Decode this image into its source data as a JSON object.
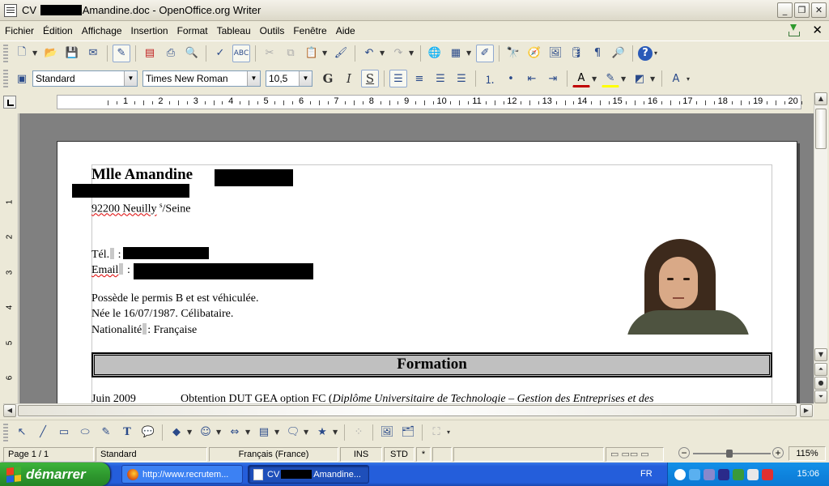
{
  "window": {
    "title_prefix": "CV",
    "title_suffix": "Amandine.doc - OpenOffice.org Writer",
    "minimize": "_",
    "maximize": "❐",
    "close": "✕"
  },
  "menu": {
    "items": [
      "Fichier",
      "Édition",
      "Affichage",
      "Insertion",
      "Format",
      "Tableau",
      "Outils",
      "Fenêtre",
      "Aide"
    ],
    "close_doc": "✕"
  },
  "format_toolbar": {
    "style_value": "Standard",
    "font_value": "Times New Roman",
    "size_value": "10,5",
    "bold": "G",
    "italic": "I",
    "underline": "S"
  },
  "ruler": {
    "numbers": [
      "1",
      "2",
      "3",
      "4",
      "5",
      "6",
      "7",
      "8",
      "9",
      "10",
      "11",
      "12",
      "13",
      "14",
      "15",
      "16",
      "17",
      "18",
      "19",
      "20"
    ],
    "vertical_numbers": [
      "1",
      "2",
      "3",
      "4",
      "5",
      "6"
    ]
  },
  "document": {
    "name_text": "Mlle Amandine",
    "city": "92200 Neuilly",
    "city_sup": "s",
    "city_rest": "/Seine",
    "tel_label": "Tél.",
    "tel_sep": ":",
    "email_label": "Email",
    "email_sep": ":",
    "line_permis": "Possède le permis B et est véhiculée.",
    "line_born": "Née le  16/07/1987. Célibataire.",
    "nat_label": "Nationalité",
    "nat_value": ": Française",
    "section_title": "Formation",
    "formation_date": "Juin 2009",
    "formation_text": "Obtention  DUT  GEA  option  FC  (",
    "formation_italic": "Diplôme Universitaire de Technologie – Gestion des Entreprises et des"
  },
  "statusbar": {
    "page": "Page 1 / 1",
    "style": "Standard",
    "language": "Français (France)",
    "ins": "INS",
    "std": "STD",
    "star": "*",
    "zoom": "115%",
    "zoom_level_percent": 115
  },
  "taskbar": {
    "start": "démarrer",
    "task1": "http://www.recrutem...",
    "task2_prefix": "CV",
    "task2_suffix": "Amandine...",
    "lang": "FR",
    "clock": "15:06"
  },
  "colors": {
    "taskbar_blue": "#245edb",
    "start_green": "#2f9a2f",
    "workspace_gray": "#808080",
    "section_gray": "#c0c0c0"
  }
}
